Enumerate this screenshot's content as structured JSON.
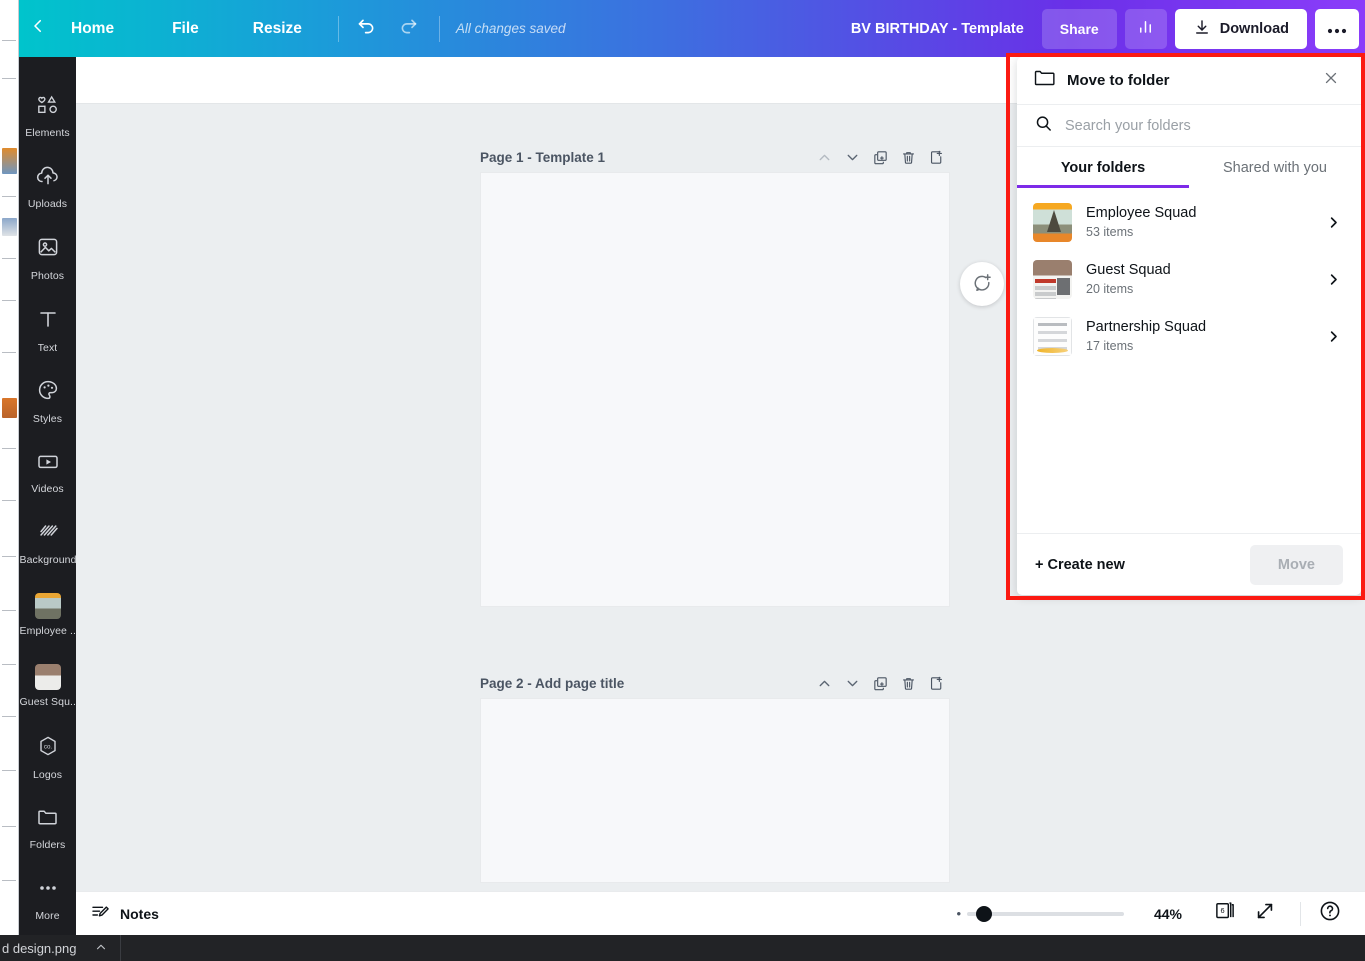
{
  "topbar": {
    "back_icon": "chevron-left-icon",
    "home_label": "Home",
    "file_label": "File",
    "resize_label": "Resize",
    "undo_icon": "undo-icon",
    "redo_icon": "redo-icon",
    "status_text": "All changes saved",
    "design_title": "BV BIRTHDAY - Template",
    "share_label": "Share",
    "stats_icon": "bar-chart-icon",
    "download_icon": "download-icon",
    "download_label": "Download",
    "more_label": "•••",
    "gradient_from": "#00c4cc",
    "gradient_to": "#8b3dfa"
  },
  "sidebar": {
    "items": [
      {
        "label": "Elements",
        "icon": "shapes-icon"
      },
      {
        "label": "Uploads",
        "icon": "upload-cloud-icon"
      },
      {
        "label": "Photos",
        "icon": "image-icon"
      },
      {
        "label": "Text",
        "icon": "text-t-icon"
      },
      {
        "label": "Styles",
        "icon": "palette-icon"
      },
      {
        "label": "Videos",
        "icon": "video-icon"
      },
      {
        "label": "Background",
        "icon": "background-hatch-icon"
      },
      {
        "label": "Employee ...",
        "icon": "folder-thumb-employee"
      },
      {
        "label": "Guest Squ...",
        "icon": "folder-thumb-guest"
      },
      {
        "label": "Logos",
        "icon": "logos-hex-icon"
      },
      {
        "label": "Folders",
        "icon": "folder-icon"
      },
      {
        "label": "More",
        "icon": "ellipsis-icon"
      }
    ]
  },
  "canvas": {
    "pages": [
      {
        "title": "Page 1 - Template 1",
        "actions": [
          "move-up-icon",
          "move-down-icon",
          "duplicate-icon",
          "delete-icon",
          "add-page-icon"
        ]
      },
      {
        "title": "Page 2 - Add page title",
        "actions": [
          "move-up-icon",
          "move-down-icon",
          "duplicate-icon",
          "delete-icon",
          "add-page-icon"
        ]
      }
    ],
    "comment_fab_icon": "add-comment-icon"
  },
  "bottombar": {
    "notes_icon": "notes-pencil-icon",
    "notes_label": "Notes",
    "zoom_value": "44%",
    "zoom_percent": 44,
    "page_count": "6",
    "grid_icon": "page-grid-icon",
    "fullscreen_icon": "expand-icon",
    "help_icon": "help-question-icon"
  },
  "move_to_folder": {
    "header_icon": "folder-icon",
    "title": "Move to folder",
    "close_icon": "close-icon",
    "search_icon": "search-icon",
    "search_value": "",
    "search_placeholder": "Search your folders",
    "tabs": [
      {
        "label": "Your folders",
        "active": true
      },
      {
        "label": "Shared with you",
        "active": false
      }
    ],
    "accent_color": "#7d2ae8",
    "outline_color": "#fb1a12",
    "folders": [
      {
        "name": "Employee Squad",
        "count": "53 items",
        "thumb": "employee-squad-thumbnail",
        "chevron": "chevron-right-icon"
      },
      {
        "name": "Guest Squad",
        "count": "20 items",
        "thumb": "guest-squad-thumbnail",
        "chevron": "chevron-right-icon"
      },
      {
        "name": "Partnership Squad",
        "count": "17 items",
        "thumb": "partnership-squad-thumbnail",
        "chevron": "chevron-right-icon"
      }
    ],
    "create_new_label": "+ Create new",
    "move_label": "Move",
    "move_disabled": true
  },
  "taskbar": {
    "item_label": "d design.png",
    "chevron_icon": "chevron-up-icon"
  }
}
